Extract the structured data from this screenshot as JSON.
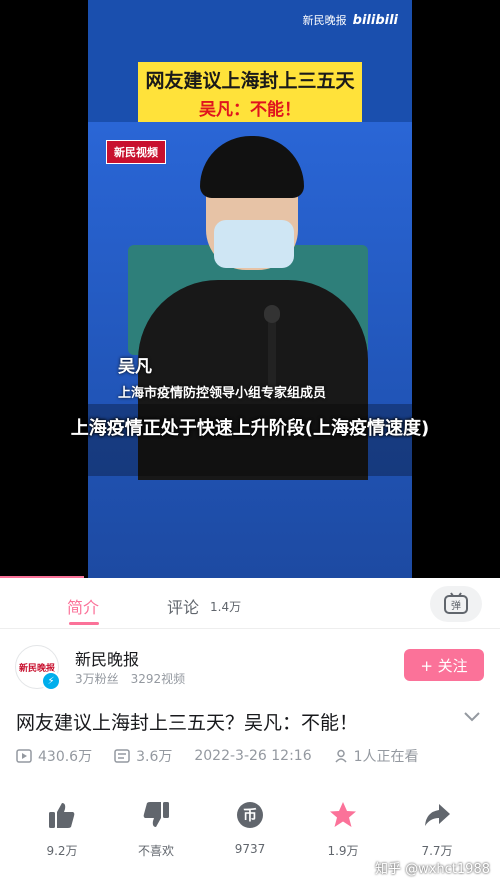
{
  "video": {
    "watermark_source": "新民晚报",
    "watermark_brand": "bilibili",
    "headline_line1": "网友建议上海封上三五天",
    "headline_line2": "吴凡：不能！",
    "brand_tag": "新民视频",
    "speaker_name": "吴凡",
    "speaker_title": "上海市疫情防控领导小组专家组成员",
    "subtitle": "上海疫情正处于快速上升阶段(上海疫情速度)"
  },
  "tabs": {
    "intro": "简介",
    "comments": "评论",
    "comments_count": "1.4万"
  },
  "uploader": {
    "avatar_text": "新民晚报",
    "name": "新民晚报",
    "stats": "3万粉丝　3292视频",
    "follow_label": "+ 关注"
  },
  "video_info": {
    "title": "网友建议上海封上三五天？吴凡：不能！",
    "views": "430.6万",
    "danmaku": "3.6万",
    "date": "2022-3-26 12:16",
    "watching": "1人正在看"
  },
  "actions": {
    "like": "9.2万",
    "dislike": "不喜欢",
    "coin": "9737",
    "favorite": "1.9万",
    "share": "7.7万"
  },
  "watermark": "知乎 @wxhct1988",
  "colors": {
    "accent": "#fb7299",
    "headline_bg": "#ffe23a",
    "headline_red": "#e0141e",
    "verified": "#00aeec"
  }
}
